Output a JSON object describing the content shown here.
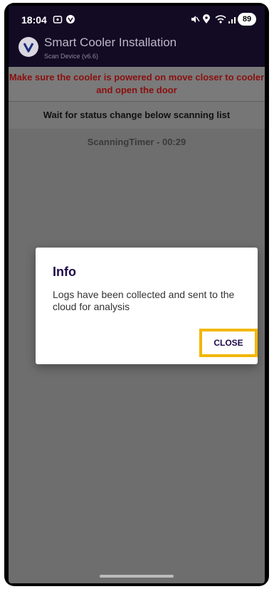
{
  "status_bar": {
    "time": "18:04",
    "battery": "89"
  },
  "app_bar": {
    "title": "Smart Cooler Installation",
    "subtitle": "Scan Device (v6.6)"
  },
  "warning": {
    "text": "Make sure the cooler is powered on move closer to cooler and open the door",
    "color": "#8b0f0f"
  },
  "scan": {
    "instruction": "Wait for status change below scanning list",
    "timer": "ScanningTimer - 00:29"
  },
  "dialog": {
    "title": "Info",
    "message": "Logs have been collected and sent to the cloud for analysis",
    "close_label": "CLOSE",
    "highlight_color": "#f2b705"
  },
  "icons": [
    "screenshot-icon",
    "vpn-icon",
    "mute-icon",
    "location-icon",
    "wifi-icon",
    "signal-icon",
    "app-logo-icon"
  ]
}
